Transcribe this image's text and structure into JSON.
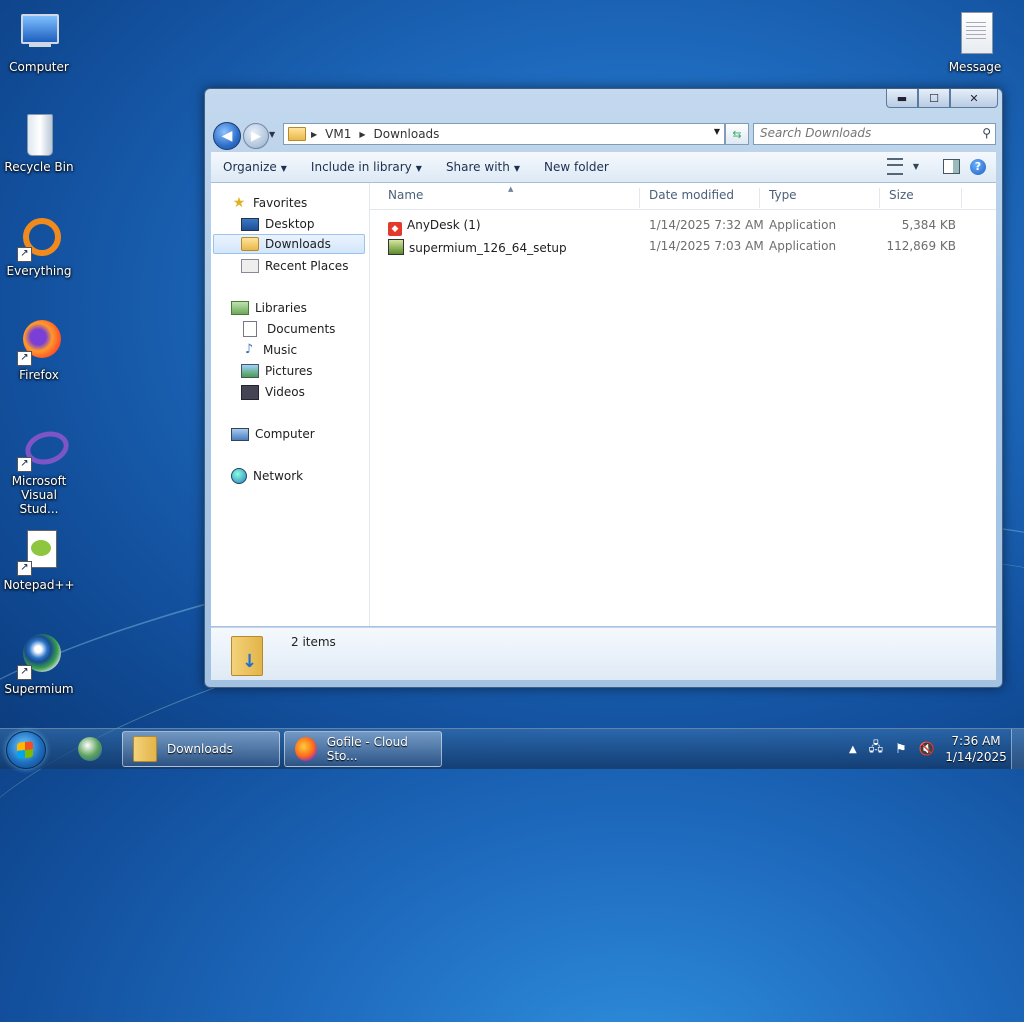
{
  "desktop": {
    "icons": [
      {
        "label": "Computer"
      },
      {
        "label": "Recycle Bin"
      },
      {
        "label": "Everything"
      },
      {
        "label": "Firefox"
      },
      {
        "label": "Microsoft Visual Stud..."
      },
      {
        "label": "Notepad++"
      },
      {
        "label": "Supermium"
      },
      {
        "label": "Message"
      }
    ]
  },
  "window": {
    "caption": {
      "minimize": "▬",
      "maximize": "☐",
      "close": "✕"
    },
    "address": {
      "crumbs": [
        "VM1",
        "Downloads"
      ]
    },
    "search": {
      "placeholder": "Search Downloads"
    },
    "toolbar": {
      "organize": "Organize",
      "include_in_library": "Include in library",
      "share_with": "Share with",
      "new_folder": "New folder"
    },
    "nav": {
      "favorites": "Favorites",
      "desktop": "Desktop",
      "downloads": "Downloads",
      "recent_places": "Recent Places",
      "libraries": "Libraries",
      "documents": "Documents",
      "music": "Music",
      "pictures": "Pictures",
      "videos": "Videos",
      "computer": "Computer",
      "network": "Network"
    },
    "columns": {
      "name": "Name",
      "date_modified": "Date modified",
      "type": "Type",
      "size": "Size"
    },
    "files": [
      {
        "name": "AnyDesk (1)",
        "date": "1/14/2025 7:32 AM",
        "type": "Application",
        "size": "5,384 KB"
      },
      {
        "name": "supermium_126_64_setup",
        "date": "1/14/2025 7:03 AM",
        "type": "Application",
        "size": "112,869 KB"
      }
    ],
    "details": {
      "count": "2 items"
    }
  },
  "taskbar": {
    "tasks": [
      {
        "label": "Downloads"
      },
      {
        "label": "Gofile - Cloud Sto..."
      }
    ],
    "tray": {
      "show_hidden": "▲"
    },
    "clock": {
      "time": "7:36 AM",
      "date": "1/14/2025"
    }
  }
}
